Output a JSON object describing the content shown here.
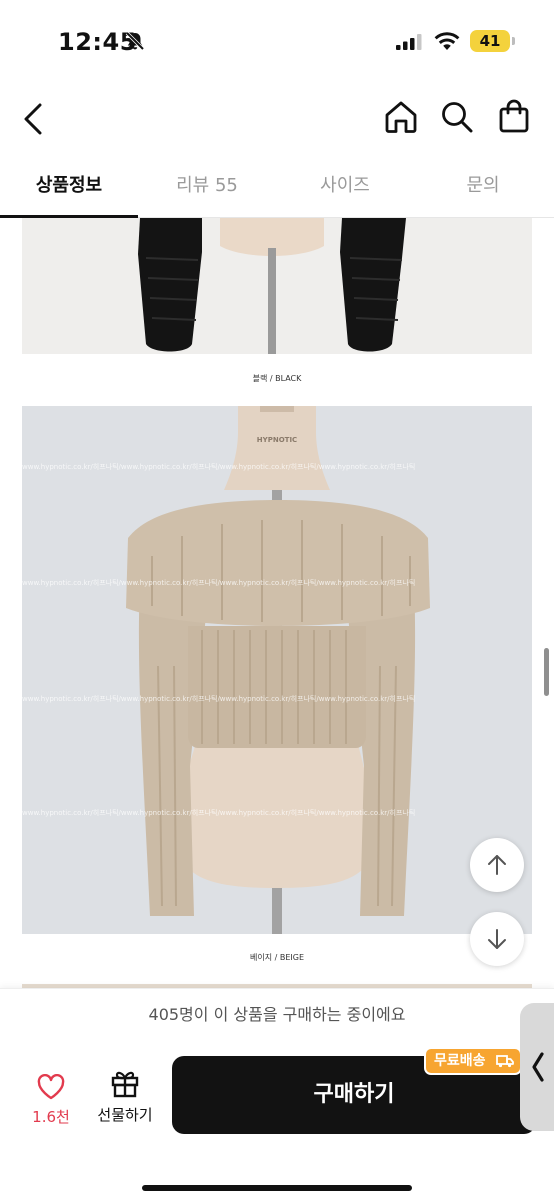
{
  "status_bar": {
    "time": "12:45",
    "battery_level": "41"
  },
  "nav": {
    "back_icon": "chevron-left-icon",
    "home_icon": "home-icon",
    "search_icon": "search-icon",
    "cart_icon": "shopping-bag-icon"
  },
  "tabs": [
    {
      "label": "상품정보",
      "active": true
    },
    {
      "label": "리뷰 55",
      "active": false
    },
    {
      "label": "사이즈",
      "active": false
    },
    {
      "label": "문의",
      "active": false
    }
  ],
  "content": {
    "caption_black": "블랙 / BLACK",
    "caption_beige": "베이지 / BEIGE",
    "mannequin_brand": "HYPNOTIC",
    "watermark_text": "www.hypnotic.co.kr/히프나틱/www.hypnotic.co.kr/히프나틱/www.hypnotic.co.kr/히프나틱/www.hypnotic.co.kr/히프나틱"
  },
  "notice": {
    "text": "405명이 이 상품을 구매하는 중이에요"
  },
  "bottom_bar": {
    "like_count": "1.6천",
    "gift_label": "선물하기",
    "buy_label": "구매하기",
    "free_shipping_badge": "무료배송"
  },
  "colors": {
    "accent_like": "#e23b4e",
    "buy_button": "#121212",
    "free_shipping": "#f7a531",
    "sweater_beige": "#cbbba6",
    "sweater_black": "#141414"
  }
}
